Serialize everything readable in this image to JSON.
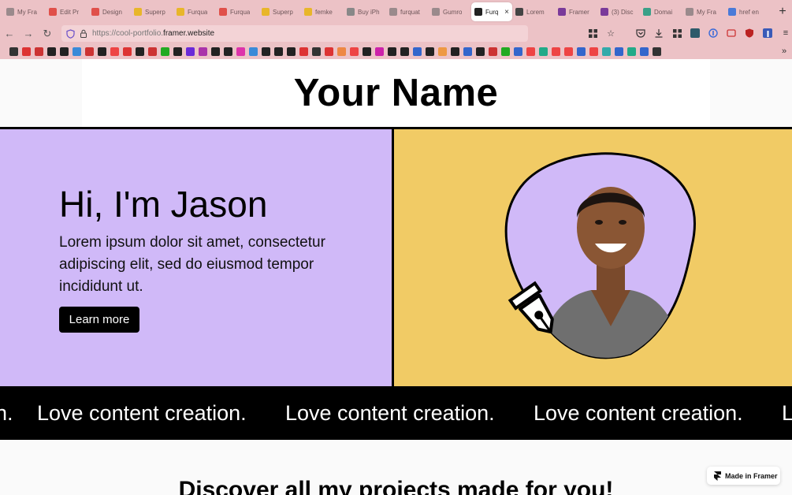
{
  "browser": {
    "tabs": [
      {
        "label": "My Fra",
        "color": "#9a8a8c"
      },
      {
        "label": "Edit Pr",
        "color": "#e0504a"
      },
      {
        "label": "Design",
        "color": "#e0504a"
      },
      {
        "label": "Superp",
        "color": "#e8b62a"
      },
      {
        "label": "Furqua",
        "color": "#e8b62a"
      },
      {
        "label": "Furqua",
        "color": "#e0504a"
      },
      {
        "label": "Superp",
        "color": "#e8b62a"
      },
      {
        "label": "femke",
        "color": "#e8b62a"
      },
      {
        "label": "Buy iPh",
        "color": "#888888"
      },
      {
        "label": "furquat",
        "color": "#9a8a8c"
      },
      {
        "label": "Gumro",
        "color": "#9a8a8c"
      },
      {
        "label": "Furq",
        "color": "#222222",
        "active": true
      },
      {
        "label": "Lorem",
        "color": "#444444"
      },
      {
        "label": "Framer",
        "color": "#7a3a9a"
      },
      {
        "label": "(3) Disc",
        "color": "#7a3a9a"
      },
      {
        "label": "Domai",
        "color": "#3aa088"
      },
      {
        "label": "My Fra",
        "color": "#9a8a8c"
      },
      {
        "label": "href en",
        "color": "#4a7ad8"
      }
    ],
    "active_tab_close": "×",
    "new_tab": "+",
    "back": "←",
    "forward": "→",
    "reload": "↻",
    "url_prefix": "https://cool-portfolio.",
    "url_domain": "framer.website",
    "menu": "≡",
    "bookmarks_more": "»",
    "bookmark_colors": [
      "#333",
      "#d33",
      "#c33",
      "#222",
      "#222",
      "#3a8ad8",
      "#c33",
      "#222",
      "#e44",
      "#d33",
      "#222",
      "#c33",
      "#2a2",
      "#222",
      "#6a2ad8",
      "#a3a",
      "#222",
      "#222",
      "#d3a",
      "#3a8ad8",
      "#222",
      "#222",
      "#222",
      "#d33",
      "#333",
      "#d33",
      "#e84",
      "#e44",
      "#222",
      "#c2a",
      "#222",
      "#222",
      "#36c",
      "#222",
      "#e94",
      "#222",
      "#36c",
      "#222",
      "#c33",
      "#2a2",
      "#36c",
      "#e44",
      "#2a8",
      "#e44",
      "#e44",
      "#36c",
      "#e44",
      "#3aa",
      "#36c",
      "#2a8",
      "#36c",
      "#333"
    ]
  },
  "site": {
    "title": "Your Name",
    "greeting": "Hi, I'm Jason",
    "intro": "Lorem ipsum dolor sit amet, consectetur adipiscing elit, sed do eiusmod tempor incididunt ut.",
    "cta_label": "Learn more",
    "marquee": [
      "n.",
      "Love content creation.",
      "Love content creation.",
      "Love content creation.",
      "L"
    ],
    "projects_heading": "Discover all my projects made for you!",
    "badge_label": "Made in Framer",
    "colors": {
      "hero_left": "#d0b9f8",
      "hero_right": "#f1cb65",
      "ink": "#000000"
    }
  }
}
